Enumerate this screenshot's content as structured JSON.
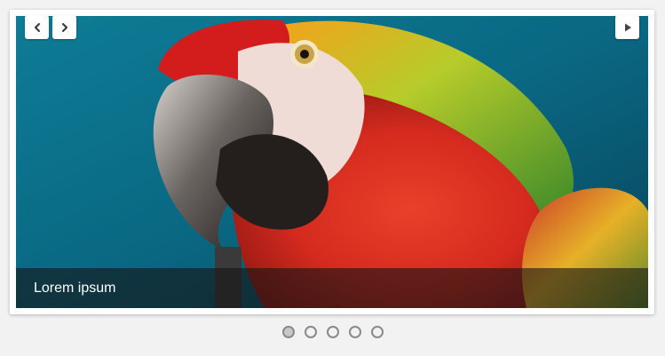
{
  "slider": {
    "caption": "Lorem ipsum",
    "buttons": {
      "prev_icon": "chevron-left-icon",
      "next_icon": "chevron-right-icon",
      "play_icon": "play-icon"
    },
    "slide_count": 5,
    "active_index": 0,
    "colors": {
      "page_bg": "#f2f2f2",
      "frame_bg": "#ffffff",
      "caption_overlay": "rgba(20,20,20,0.6)",
      "caption_text": "#ffffff",
      "dot_border": "#8a8a8a",
      "dot_active": "#c8c8c8"
    }
  }
}
